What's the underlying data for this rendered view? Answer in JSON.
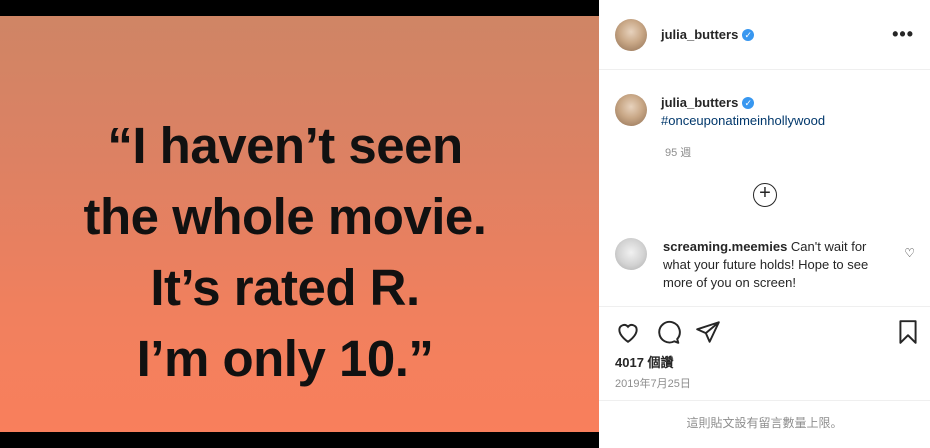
{
  "post": {
    "quote_lines": [
      "“I haven’t seen",
      "the whole movie.",
      "It’s rated R.",
      "I’m only 10.”"
    ]
  },
  "header": {
    "username": "julia_butters",
    "verified_icon": "verified-badge-icon",
    "more_label": "•••"
  },
  "caption": {
    "username": "julia_butters",
    "hashtag": "#onceuponatimeinhollywood",
    "age": "95 週"
  },
  "load_more_label": "+",
  "comment": {
    "username": "screaming.meemies",
    "text": "Can't wait for what your future holds! Hope to see more of you on screen!"
  },
  "stats": {
    "likes": "4017 個讚",
    "date": "2019年7月25日"
  },
  "footer": {
    "limit_notice": "這則貼文設有留言數量上限。"
  },
  "colors": {
    "accent": "#3897f0",
    "media_top": "#cf8565",
    "media_bottom": "#f97f5c"
  }
}
